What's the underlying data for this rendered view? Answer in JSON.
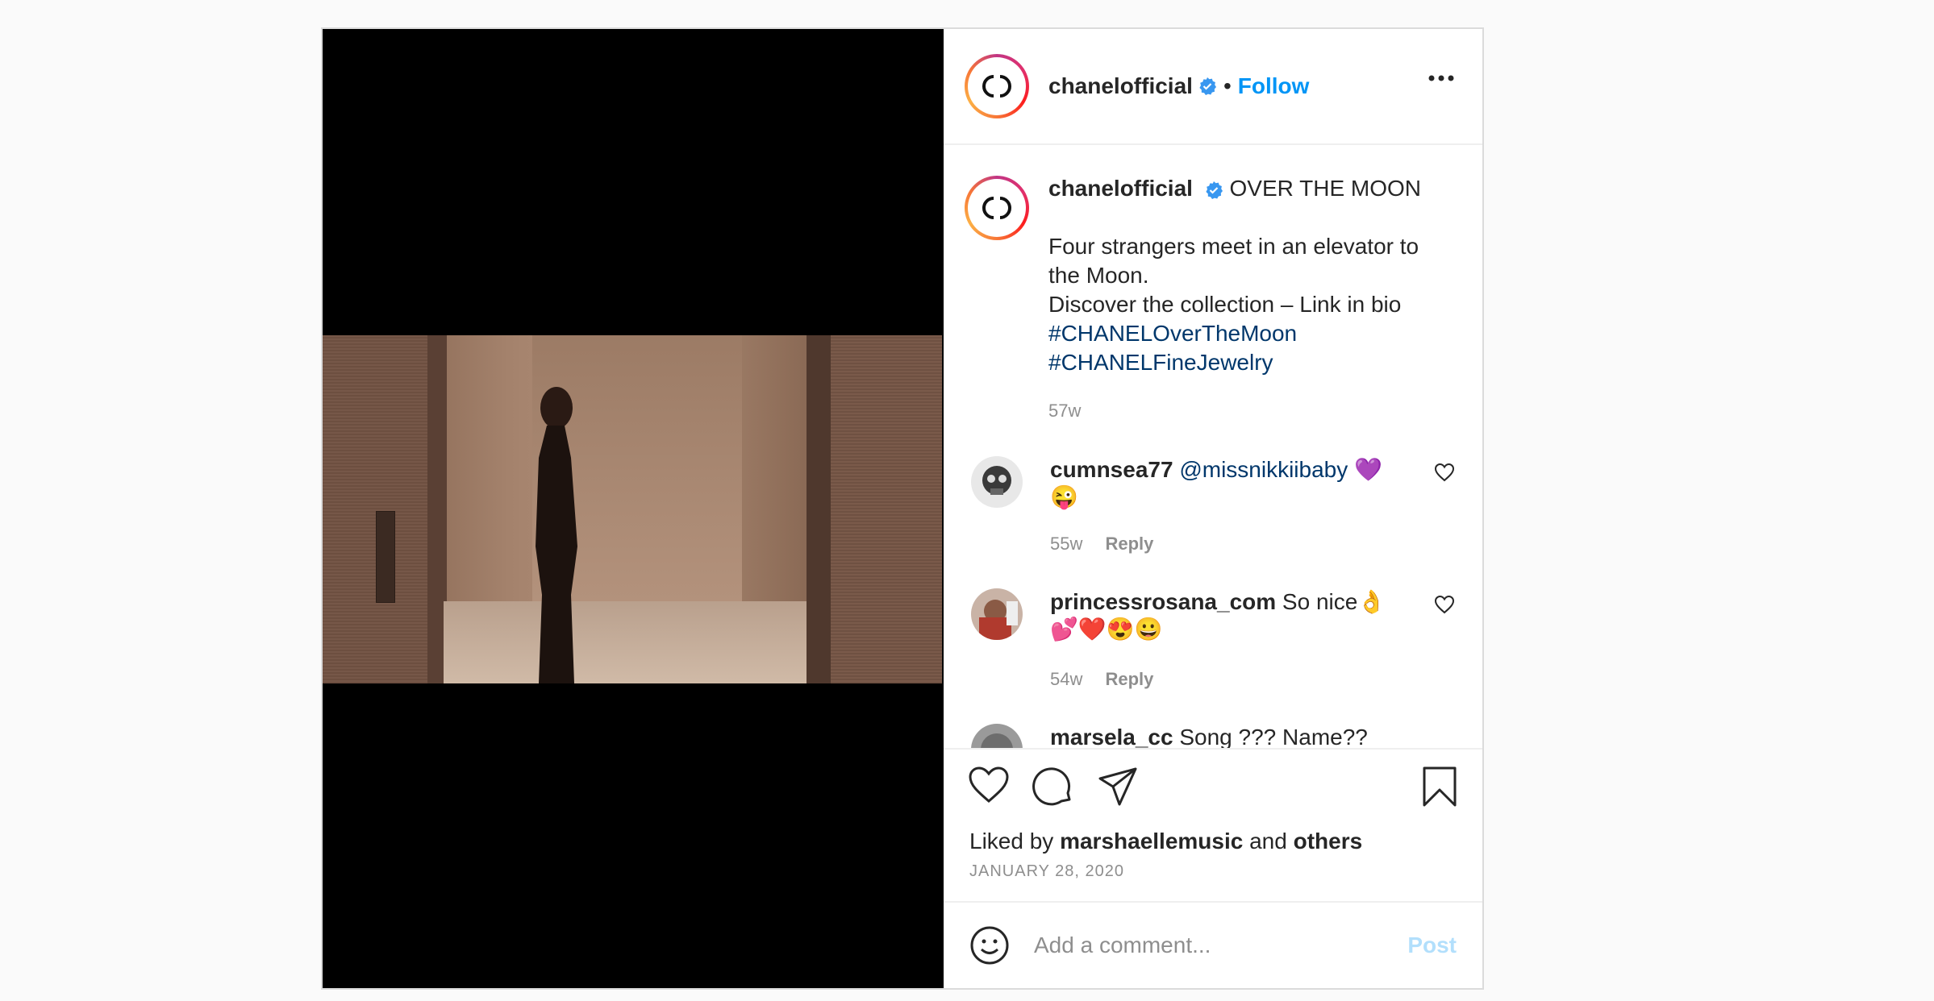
{
  "header": {
    "username": "chanelofficial",
    "separator": "•",
    "follow_label": "Follow",
    "more_icon": "more-horizontal-icon"
  },
  "caption": {
    "username": "chanelofficial",
    "title": "OVER THE MOON",
    "line1": "Four strangers meet in an elevator to the Moon.",
    "line2": "Discover the collection – Link in bio",
    "hashtag1": "#CHANELOverTheMoon",
    "hashtag2": "#CHANELFineJewelry",
    "time": "57w"
  },
  "comments": [
    {
      "username": "cumnsea77",
      "mention": "@missnikkiibaby",
      "text": "💜😜",
      "time": "55w",
      "reply": "Reply"
    },
    {
      "username": "princessrosana_com",
      "text": "So nice👌💕❤️😍😀",
      "time": "54w",
      "reply": "Reply"
    },
    {
      "username": "marsela_cc",
      "text": "Song ??? Name??"
    }
  ],
  "actions": {
    "liked_prefix": "Liked by",
    "liked_user": "marshaellemusic",
    "liked_and": "and",
    "liked_others": "others",
    "date": "JANUARY 28, 2020"
  },
  "add_comment": {
    "placeholder": "Add a comment...",
    "post_label": "Post"
  },
  "colors": {
    "link_blue": "#0095f6",
    "hashtag": "#00376b",
    "muted": "#8e8e8e",
    "post_disabled": "#b2dffc"
  }
}
